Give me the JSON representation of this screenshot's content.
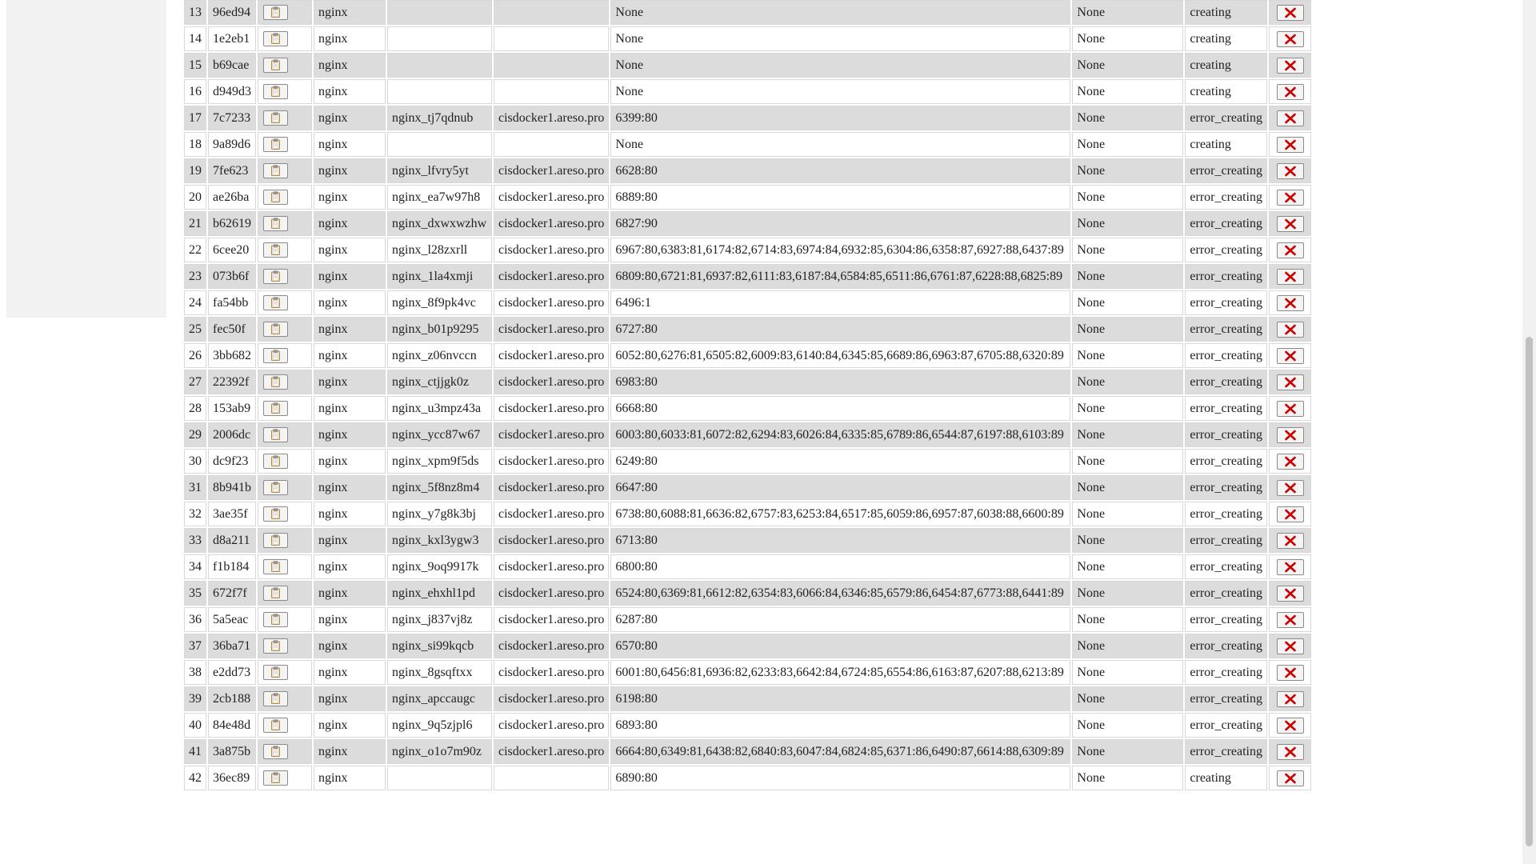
{
  "colors": {
    "row_odd": "#dcdcdc",
    "row_even": "#ffffff",
    "delete_icon": "#cc0000",
    "cell_border": "#d8d8d8",
    "sidebar_bg": "#f2f2f2"
  },
  "icons": {
    "copy": "clipboard-icon",
    "delete": "red-x-icon"
  },
  "table": {
    "rows": [
      {
        "num": "13",
        "id": "96ed94",
        "image": "nginx",
        "name": "",
        "host": "",
        "ports": "None",
        "status": "None",
        "state": "creating"
      },
      {
        "num": "14",
        "id": "1e2eb1",
        "image": "nginx",
        "name": "",
        "host": "",
        "ports": "None",
        "status": "None",
        "state": "creating"
      },
      {
        "num": "15",
        "id": "b69cae",
        "image": "nginx",
        "name": "",
        "host": "",
        "ports": "None",
        "status": "None",
        "state": "creating"
      },
      {
        "num": "16",
        "id": "d949d3",
        "image": "nginx",
        "name": "",
        "host": "",
        "ports": "None",
        "status": "None",
        "state": "creating"
      },
      {
        "num": "17",
        "id": "7c7233",
        "image": "nginx",
        "name": "nginx_tj7qdnub",
        "host": "cisdocker1.areso.pro",
        "ports": "6399:80",
        "status": "None",
        "state": "error_creating"
      },
      {
        "num": "18",
        "id": "9a89d6",
        "image": "nginx",
        "name": "",
        "host": "",
        "ports": "None",
        "status": "None",
        "state": "creating"
      },
      {
        "num": "19",
        "id": "7fe623",
        "image": "nginx",
        "name": "nginx_lfvry5yt",
        "host": "cisdocker1.areso.pro",
        "ports": "6628:80",
        "status": "None",
        "state": "error_creating"
      },
      {
        "num": "20",
        "id": "ae26ba",
        "image": "nginx",
        "name": "nginx_ea7w97h8",
        "host": "cisdocker1.areso.pro",
        "ports": "6889:80",
        "status": "None",
        "state": "error_creating"
      },
      {
        "num": "21",
        "id": "b62619",
        "image": "nginx",
        "name": "nginx_dxwxwzhw",
        "host": "cisdocker1.areso.pro",
        "ports": "6827:90",
        "status": "None",
        "state": "error_creating"
      },
      {
        "num": "22",
        "id": "6cee20",
        "image": "nginx",
        "name": "nginx_l28zxrll",
        "host": "cisdocker1.areso.pro",
        "ports": "6967:80,6383:81,6174:82,6714:83,6974:84,6932:85,6304:86,6358:87,6927:88,6437:89",
        "status": "None",
        "state": "error_creating"
      },
      {
        "num": "23",
        "id": "073b6f",
        "image": "nginx",
        "name": "nginx_1la4xmji",
        "host": "cisdocker1.areso.pro",
        "ports": "6809:80,6721:81,6937:82,6111:83,6187:84,6584:85,6511:86,6761:87,6228:88,6825:89",
        "status": "None",
        "state": "error_creating"
      },
      {
        "num": "24",
        "id": "fa54bb",
        "image": "nginx",
        "name": "nginx_8f9pk4vc",
        "host": "cisdocker1.areso.pro",
        "ports": "6496:1",
        "status": "None",
        "state": "error_creating"
      },
      {
        "num": "25",
        "id": "fec50f",
        "image": "nginx",
        "name": "nginx_b01p9295",
        "host": "cisdocker1.areso.pro",
        "ports": "6727:80",
        "status": "None",
        "state": "error_creating"
      },
      {
        "num": "26",
        "id": "3bb682",
        "image": "nginx",
        "name": "nginx_z06nvccn",
        "host": "cisdocker1.areso.pro",
        "ports": "6052:80,6276:81,6505:82,6009:83,6140:84,6345:85,6689:86,6963:87,6705:88,6320:89",
        "status": "None",
        "state": "error_creating"
      },
      {
        "num": "27",
        "id": "22392f",
        "image": "nginx",
        "name": "nginx_ctjjgk0z",
        "host": "cisdocker1.areso.pro",
        "ports": "6983:80",
        "status": "None",
        "state": "error_creating"
      },
      {
        "num": "28",
        "id": "153ab9",
        "image": "nginx",
        "name": "nginx_u3mpz43a",
        "host": "cisdocker1.areso.pro",
        "ports": "6668:80",
        "status": "None",
        "state": "error_creating"
      },
      {
        "num": "29",
        "id": "2006dc",
        "image": "nginx",
        "name": "nginx_ycc87w67",
        "host": "cisdocker1.areso.pro",
        "ports": "6003:80,6033:81,6072:82,6294:83,6026:84,6335:85,6789:86,6544:87,6197:88,6103:89",
        "status": "None",
        "state": "error_creating"
      },
      {
        "num": "30",
        "id": "dc9f23",
        "image": "nginx",
        "name": "nginx_xpm9f5ds",
        "host": "cisdocker1.areso.pro",
        "ports": "6249:80",
        "status": "None",
        "state": "error_creating"
      },
      {
        "num": "31",
        "id": "8b941b",
        "image": "nginx",
        "name": "nginx_5f8nz8m4",
        "host": "cisdocker1.areso.pro",
        "ports": "6647:80",
        "status": "None",
        "state": "error_creating"
      },
      {
        "num": "32",
        "id": "3ae35f",
        "image": "nginx",
        "name": "nginx_y7g8k3bj",
        "host": "cisdocker1.areso.pro",
        "ports": "6738:80,6088:81,6636:82,6757:83,6253:84,6517:85,6059:86,6957:87,6038:88,6600:89",
        "status": "None",
        "state": "error_creating"
      },
      {
        "num": "33",
        "id": "d8a211",
        "image": "nginx",
        "name": "nginx_kxl3ygw3",
        "host": "cisdocker1.areso.pro",
        "ports": "6713:80",
        "status": "None",
        "state": "error_creating"
      },
      {
        "num": "34",
        "id": "f1b184",
        "image": "nginx",
        "name": "nginx_9oq9917k",
        "host": "cisdocker1.areso.pro",
        "ports": "6800:80",
        "status": "None",
        "state": "error_creating"
      },
      {
        "num": "35",
        "id": "672f7f",
        "image": "nginx",
        "name": "nginx_ehxhl1pd",
        "host": "cisdocker1.areso.pro",
        "ports": "6524:80,6369:81,6612:82,6354:83,6066:84,6346:85,6579:86,6454:87,6773:88,6441:89",
        "status": "None",
        "state": "error_creating"
      },
      {
        "num": "36",
        "id": "5a5eac",
        "image": "nginx",
        "name": "nginx_j837vj8z",
        "host": "cisdocker1.areso.pro",
        "ports": "6287:80",
        "status": "None",
        "state": "error_creating"
      },
      {
        "num": "37",
        "id": "36ba71",
        "image": "nginx",
        "name": "nginx_si99kqcb",
        "host": "cisdocker1.areso.pro",
        "ports": "6570:80",
        "status": "None",
        "state": "error_creating"
      },
      {
        "num": "38",
        "id": "e2dd73",
        "image": "nginx",
        "name": "nginx_8gsqftxx",
        "host": "cisdocker1.areso.pro",
        "ports": "6001:80,6456:81,6936:82,6233:83,6642:84,6724:85,6554:86,6163:87,6207:88,6213:89",
        "status": "None",
        "state": "error_creating"
      },
      {
        "num": "39",
        "id": "2cb188",
        "image": "nginx",
        "name": "nginx_apccaugc",
        "host": "cisdocker1.areso.pro",
        "ports": "6198:80",
        "status": "None",
        "state": "error_creating"
      },
      {
        "num": "40",
        "id": "84e48d",
        "image": "nginx",
        "name": "nginx_9q5zjpl6",
        "host": "cisdocker1.areso.pro",
        "ports": "6893:80",
        "status": "None",
        "state": "error_creating"
      },
      {
        "num": "41",
        "id": "3a875b",
        "image": "nginx",
        "name": "nginx_o1o7m90z",
        "host": "cisdocker1.areso.pro",
        "ports": "6664:80,6349:81,6438:82,6840:83,6047:84,6824:85,6371:86,6490:87,6614:88,6309:89",
        "status": "None",
        "state": "error_creating"
      },
      {
        "num": "42",
        "id": "36ec89",
        "image": "nginx",
        "name": "",
        "host": "",
        "ports": "6890:80",
        "status": "None",
        "state": "creating"
      }
    ]
  }
}
